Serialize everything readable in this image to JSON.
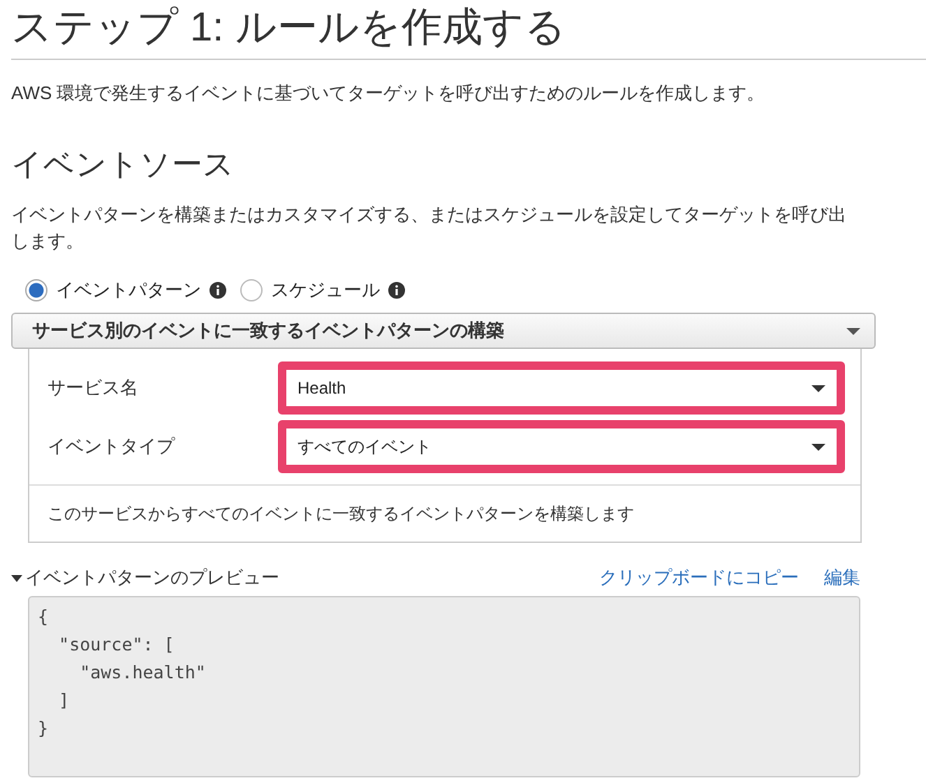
{
  "title": "ステップ 1: ルールを作成する",
  "description": "AWS 環境で発生するイベントに基づいてターゲットを呼び出すためのルールを作成します。",
  "section": {
    "heading": "イベントソース",
    "text": "イベントパターンを構築またはカスタマイズする、またはスケジュールを設定してターゲットを呼び出します。"
  },
  "source_options": [
    {
      "label": "イベントパターン",
      "selected": true
    },
    {
      "label": "スケジュール",
      "selected": false
    }
  ],
  "builder": {
    "header": "サービス別のイベントに一致するイベントパターンの構築",
    "fields": [
      {
        "label": "サービス名",
        "value": "Health",
        "highlighted": true
      },
      {
        "label": "イベントタイプ",
        "value": "すべてのイベント",
        "highlighted": true
      }
    ],
    "note": "このサービスからすべてのイベントに一致するイベントパターンを構築します"
  },
  "preview": {
    "title": "イベントパターンのプレビュー",
    "expanded": true,
    "links": [
      "クリップボードにコピー",
      "編集"
    ],
    "code_lines": [
      "{",
      "  \"source\": [",
      "    \"aws.health\"",
      "  ]",
      "}"
    ]
  }
}
